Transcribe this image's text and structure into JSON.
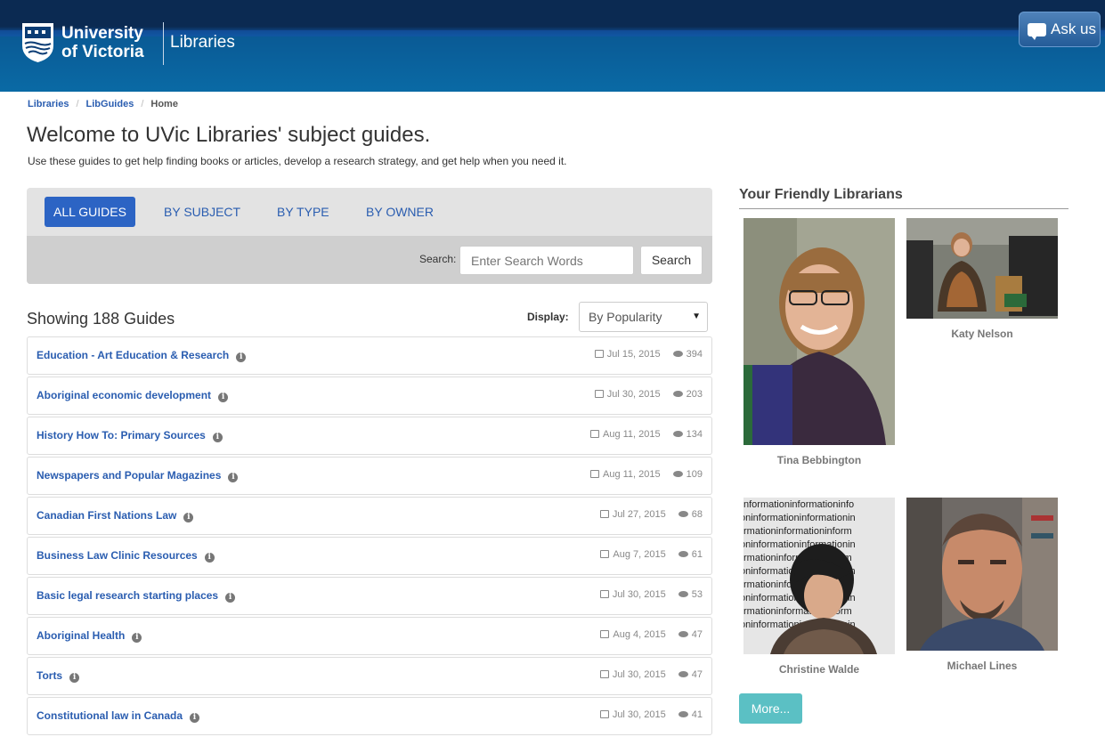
{
  "header": {
    "university_line1": "University",
    "university_line2": "of Victoria",
    "site_name": "Libraries",
    "ask_label": "Ask us"
  },
  "breadcrumb": [
    "Libraries",
    "LibGuides",
    "Home"
  ],
  "page_title": "Welcome to UVic Libraries' subject guides.",
  "intro": "Use these guides to get help finding books or articles, develop a research strategy, and get help when you need it.",
  "tabs": [
    "ALL GUIDES",
    "BY SUBJECT",
    "BY TYPE",
    "BY OWNER"
  ],
  "search": {
    "label": "Search:",
    "placeholder": "Enter Search Words",
    "button": "Search"
  },
  "showing": "Showing 188 Guides",
  "display": {
    "label": "Display:",
    "value": "By Popularity"
  },
  "guides": [
    {
      "title": "Education - Art Education & Research",
      "date": "Jul 15, 2015",
      "views": "394"
    },
    {
      "title": "Aboriginal economic development",
      "date": "Jul 30, 2015",
      "views": "203"
    },
    {
      "title": "History How To: Primary Sources",
      "date": "Aug 11, 2015",
      "views": "134"
    },
    {
      "title": "Newspapers and Popular Magazines",
      "date": "Aug 11, 2015",
      "views": "109"
    },
    {
      "title": "Canadian First Nations Law",
      "date": "Jul 27, 2015",
      "views": "68"
    },
    {
      "title": "Business Law Clinic Resources",
      "date": "Aug 7, 2015",
      "views": "61"
    },
    {
      "title": "Basic legal research starting places",
      "date": "Jul 30, 2015",
      "views": "53"
    },
    {
      "title": "Aboriginal Health",
      "date": "Aug 4, 2015",
      "views": "47"
    },
    {
      "title": "Torts",
      "date": "Jul 30, 2015",
      "views": "47"
    },
    {
      "title": "Constitutional law in Canada",
      "date": "Jul 30, 2015",
      "views": "41"
    }
  ],
  "sidebar": {
    "title": "Your Friendly Librarians",
    "librarians": [
      "Tina Bebbington",
      "Katy Nelson",
      "Christine Walde",
      "Michael Lines"
    ],
    "more": "More..."
  },
  "colors": {
    "link": "#2a5db0",
    "header": "#0a5a95",
    "active_tab": "#2c64c4",
    "more_button": "#5bc0c4"
  }
}
